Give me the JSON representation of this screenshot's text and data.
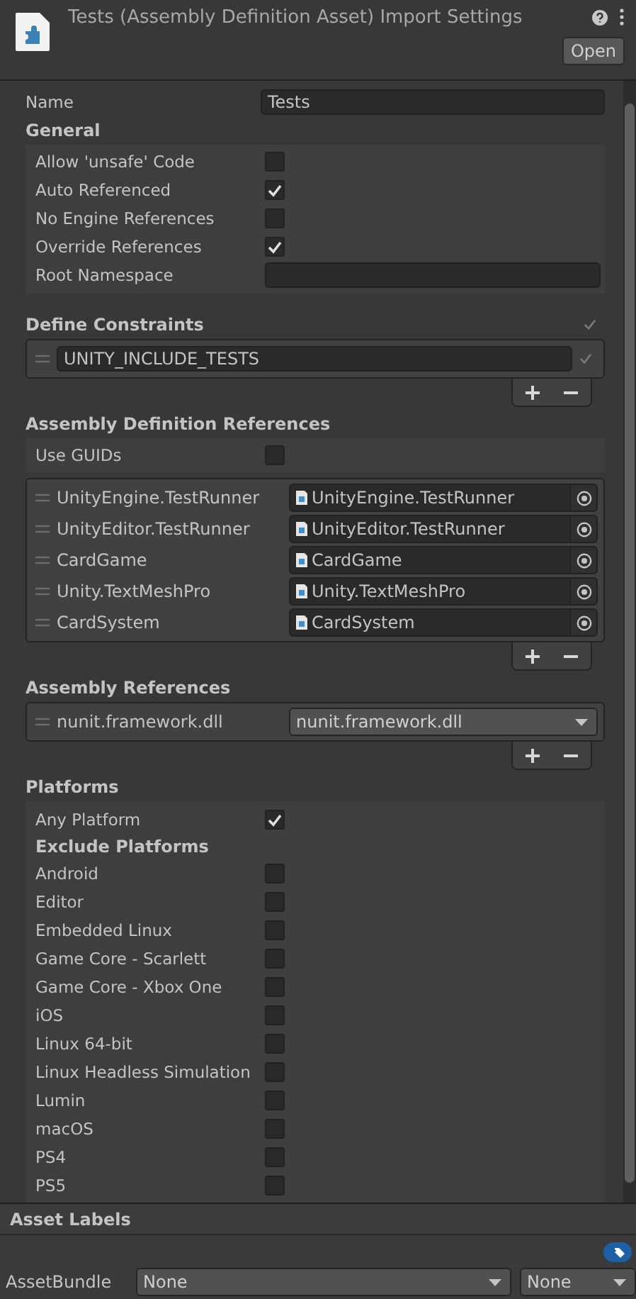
{
  "header": {
    "title": "Tests (Assembly Definition Asset) Import Settings",
    "open_button": "Open"
  },
  "name_field": {
    "label": "Name",
    "value": "Tests"
  },
  "general": {
    "title": "General",
    "rows": [
      {
        "label": "Allow 'unsafe' Code",
        "kind": "checkbox",
        "checked": false
      },
      {
        "label": "Auto Referenced",
        "kind": "checkbox",
        "checked": true
      },
      {
        "label": "No Engine References",
        "kind": "checkbox",
        "checked": false
      },
      {
        "label": "Override References",
        "kind": "checkbox",
        "checked": true
      },
      {
        "label": "Root Namespace",
        "kind": "text"
      }
    ]
  },
  "define_constraints": {
    "title": "Define Constraints",
    "items": [
      {
        "value": "UNITY_INCLUDE_TESTS"
      }
    ]
  },
  "assembly_definition_references": {
    "title": "Assembly Definition References",
    "use_guids": {
      "label": "Use GUIDs",
      "checked": false
    },
    "items": [
      {
        "name": "UnityEngine.TestRunner",
        "reference": "UnityEngine.TestRunner"
      },
      {
        "name": "UnityEditor.TestRunner",
        "reference": "UnityEditor.TestRunner"
      },
      {
        "name": "CardGame",
        "reference": "CardGame"
      },
      {
        "name": "Unity.TextMeshPro",
        "reference": "Unity.TextMeshPro"
      },
      {
        "name": "CardSystem",
        "reference": "CardSystem"
      }
    ]
  },
  "assembly_references": {
    "title": "Assembly References",
    "items": [
      {
        "name": "nunit.framework.dll",
        "value": "nunit.framework.dll"
      }
    ]
  },
  "platforms": {
    "title": "Platforms",
    "any_platform": {
      "label": "Any Platform",
      "checked": true
    },
    "exclude_title": "Exclude Platforms",
    "items": [
      {
        "label": "Android",
        "checked": false
      },
      {
        "label": "Editor",
        "checked": false
      },
      {
        "label": "Embedded Linux",
        "checked": false
      },
      {
        "label": "Game Core - Scarlett",
        "checked": false
      },
      {
        "label": "Game Core - Xbox One",
        "checked": false
      },
      {
        "label": "iOS",
        "checked": false
      },
      {
        "label": "Linux 64-bit",
        "checked": false
      },
      {
        "label": "Linux Headless Simulation",
        "checked": false
      },
      {
        "label": "Lumin",
        "checked": false
      },
      {
        "label": "macOS",
        "checked": false
      },
      {
        "label": "PS4",
        "checked": false
      },
      {
        "label": "PS5",
        "checked": false
      }
    ]
  },
  "asset_labels": {
    "title": "Asset Labels"
  },
  "asset_bundle": {
    "label": "AssetBundle",
    "name": "None",
    "variant": "None"
  }
}
